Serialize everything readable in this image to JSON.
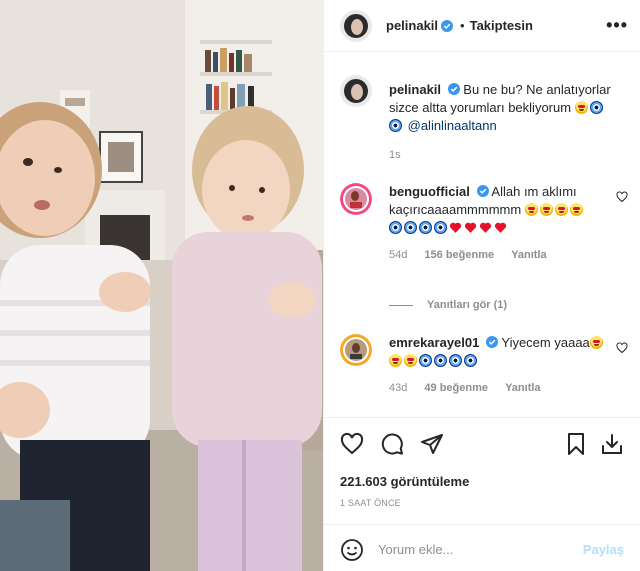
{
  "post": {
    "username": "pelinakil",
    "follow_label": "Takiptesin",
    "more_label": "•••",
    "caption": {
      "text_line": "Bu ne bu? Ne anlatıyorlar sizce altta yorumları bekliyorum",
      "mention": "@alinlinaaltann",
      "time": "1s"
    }
  },
  "comments": [
    {
      "username": "benguofficial",
      "text": "Allah ım aklımı kaçırıcaaaammmmmm",
      "age": "54d",
      "likes": "156 beğenme",
      "reply": "Yanıtla"
    },
    {
      "username": "emrekarayel01",
      "text": "Yiyecem yaaaa",
      "age": "43d",
      "likes": "49 beğenme",
      "reply": "Yanıtla"
    }
  ],
  "replies_label": "Yanıtları gör (1)",
  "stats": {
    "views": "221.603 görüntüleme",
    "posted": "1 SAAT ÖNCE"
  },
  "composer": {
    "placeholder": "Yorum ekle...",
    "post_label": "Paylaş"
  },
  "icons": {
    "like": "heart-icon",
    "comment": "comment-icon",
    "share": "paper-plane-icon",
    "save": "bookmark-icon",
    "download": "download-icon",
    "emoji": "smiley-icon"
  },
  "colors": {
    "text": "#262626",
    "muted": "#8e8e8e",
    "link": "#00376b",
    "verified": "#3897f0",
    "post_button": "#b2dffc",
    "border": "#efefef"
  }
}
